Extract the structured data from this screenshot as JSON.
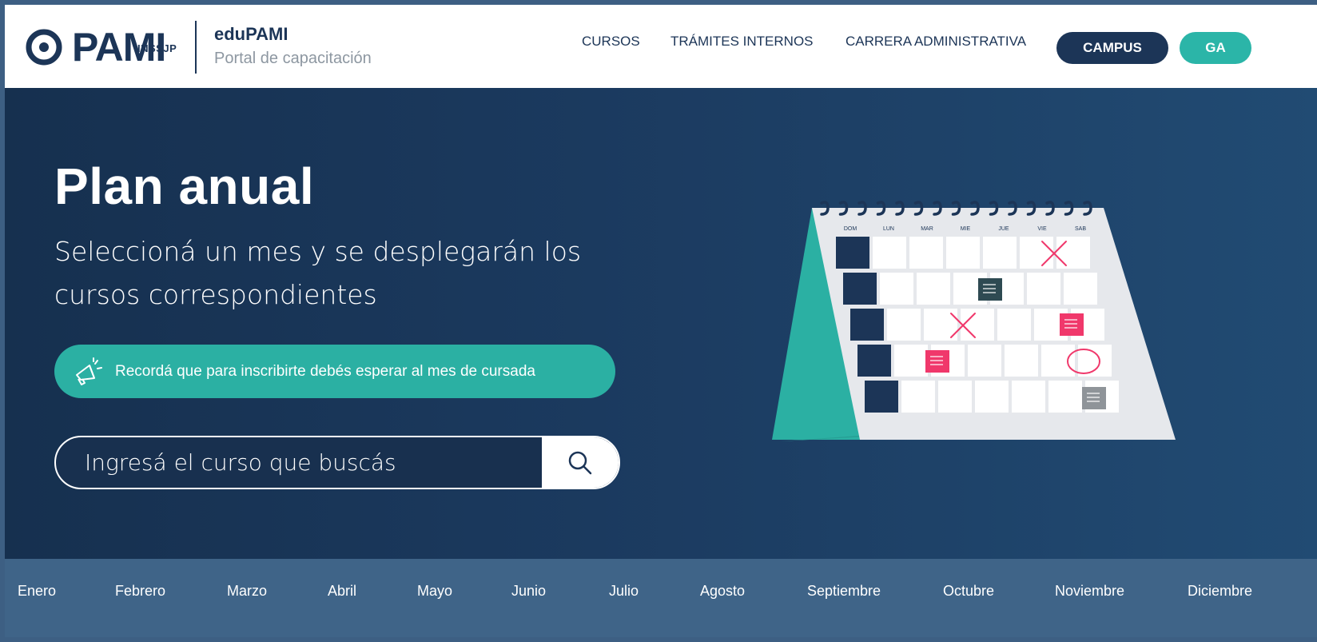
{
  "header": {
    "logo_text": "PAMI",
    "logo_sub": "INSSJP",
    "brand_title": "eduPAMI",
    "brand_subtitle": "Portal de capacitación",
    "nav": {
      "cursos": "CURSOS",
      "tramites": "TRÁMITES INTERNOS",
      "carrera": "CARRERA ADMINISTRATIVA"
    },
    "campus_label": "CAMPUS",
    "user_initials": "GA"
  },
  "hero": {
    "title": "Plan anual",
    "subtitle": "Seleccioná un mes y se desplegarán los cursos correspondientes",
    "notice": "Recordá que para inscribirte debés esperar al mes de cursada",
    "search_placeholder": "Ingresá el curso que buscás"
  },
  "calendar_days": [
    "DOM",
    "LUN",
    "MAR",
    "MIE",
    "JUE",
    "VIE",
    "SAB"
  ],
  "months": [
    "Enero",
    "Febrero",
    "Marzo",
    "Abril",
    "Mayo",
    "Junio",
    "Julio",
    "Agosto",
    "Septiembre",
    "Octubre",
    "Noviembre",
    "Diciembre"
  ],
  "colors": {
    "navy": "#1c3557",
    "teal": "#2bb0a3",
    "month_bar": "#3f6488",
    "pink": "#f0386b"
  }
}
